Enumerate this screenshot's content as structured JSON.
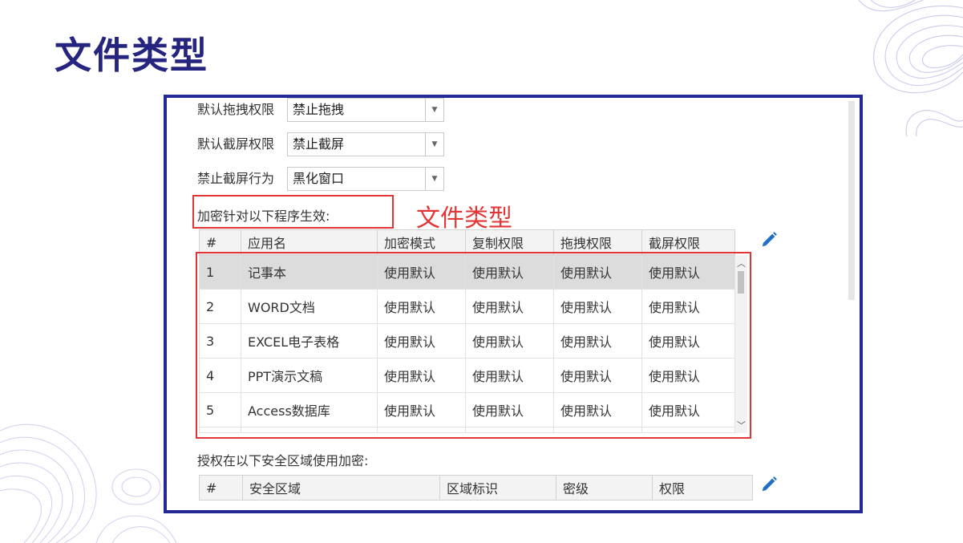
{
  "slide": {
    "title": "文件类型"
  },
  "settings": [
    {
      "label": "默认拖拽权限",
      "value": "禁止拖拽"
    },
    {
      "label": "默认截屏权限",
      "value": "禁止截屏"
    },
    {
      "label": "禁止截屏行为",
      "value": "黑化窗口"
    }
  ],
  "program_section": {
    "label": "加密针对以下程序生效:",
    "annotation": "文件类型",
    "columns": [
      "#",
      "应用名",
      "加密模式",
      "复制权限",
      "拖拽权限",
      "截屏权限"
    ],
    "rows": [
      [
        "1",
        "记事本",
        "使用默认",
        "使用默认",
        "使用默认",
        "使用默认"
      ],
      [
        "2",
        "WORD文档",
        "使用默认",
        "使用默认",
        "使用默认",
        "使用默认"
      ],
      [
        "3",
        "EXCEL电子表格",
        "使用默认",
        "使用默认",
        "使用默认",
        "使用默认"
      ],
      [
        "4",
        "PPT演示文稿",
        "使用默认",
        "使用默认",
        "使用默认",
        "使用默认"
      ],
      [
        "5",
        "Access数据库",
        "使用默认",
        "使用默认",
        "使用默认",
        "使用默认"
      ]
    ]
  },
  "zone_section": {
    "label": "授权在以下安全区域使用加密:",
    "columns": [
      "#",
      "安全区域",
      "区域标识",
      "密级",
      "权限"
    ]
  },
  "icons": {
    "edit": "pencil-icon",
    "dropdown": "triangle-down-icon",
    "scroll_up": "chevron-up-icon",
    "scroll_down": "chevron-down-icon"
  },
  "colors": {
    "title": "#25247f",
    "frame": "#252996",
    "highlight": "#e23636",
    "edit_icon": "#1e6fc8"
  }
}
